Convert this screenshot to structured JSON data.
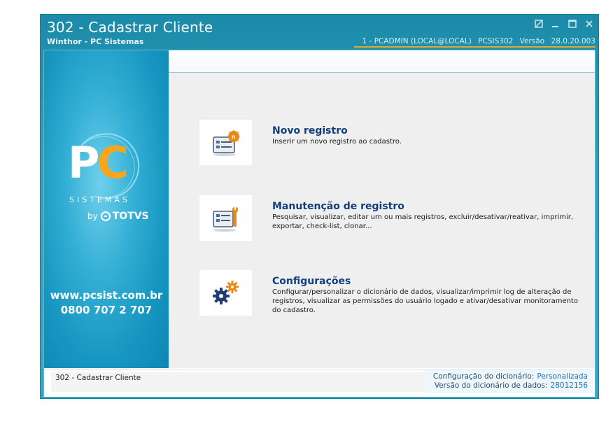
{
  "window": {
    "title": "302 - Cadastrar Cliente",
    "subtitle": "Winthor - PC Sistemas",
    "session": {
      "user": "1 - PCADMIN (LOCAL@LOCAL)",
      "program": "PCSIS302",
      "version_label": "Versão",
      "version": "28.0.20.003"
    },
    "buttons": [
      "restore",
      "minimize",
      "maximize",
      "close"
    ]
  },
  "sidebar": {
    "logo_p": "P",
    "logo_c": "C",
    "logo_sub": "SISTEMAS",
    "by": "by",
    "totvs": "TOTVS",
    "website": "www.pcsist.com.br",
    "phone": "0800 707 2 707"
  },
  "options": [
    {
      "title": "Novo registro",
      "description": "Inserir um novo registro ao cadastro.",
      "icon": "new-record-icon"
    },
    {
      "title": "Manutenção de registro",
      "description": "Pesquisar, visualizar, editar um ou mais registros, excluir/desativar/reativar, imprimir, exportar, check-list,  clonar...",
      "icon": "maintenance-icon"
    },
    {
      "title": "Configurações",
      "description": "Configurar/personalizar o dicionário de dados, visualizar/imprimir log de alteração de registros, visualizar as permissões do usuário logado e ativar/desativar monitoramento do cadastro.",
      "icon": "settings-gears-icon"
    }
  ],
  "footer": {
    "status": "302 - Cadastrar Cliente",
    "dict_config_label": "Configuração do dicionário:",
    "dict_config_value": "Personalizada",
    "dict_version_label": "Versão do dicionário de dados:",
    "dict_version_value": "28012156"
  },
  "colors": {
    "frame": "#2aa6c2",
    "accent_orange": "#f7a51c",
    "option_title": "#123e7b",
    "link_value": "#1e6fc0"
  }
}
